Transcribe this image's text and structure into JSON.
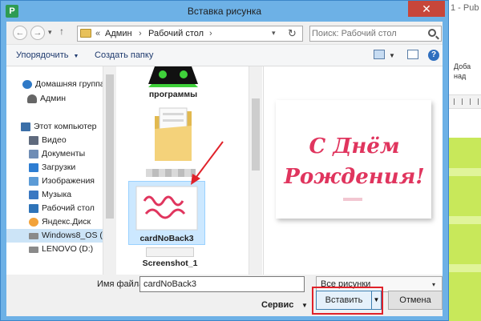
{
  "background_app": {
    "title_fragment": "1 - Pub",
    "ribbon_line1": "Доба",
    "ribbon_line2": "над"
  },
  "dialog": {
    "title": "Вставка рисунка",
    "close_glyph": "✕",
    "app_icon_glyph": "P"
  },
  "nav": {
    "back_glyph": "←",
    "forward_glyph": "→",
    "recent_glyph": "▾",
    "up_glyph": "↑",
    "crumb_prefix": "«",
    "breadcrumb": [
      "Админ",
      "Рабочий стол"
    ],
    "crumb_sep": "›",
    "address_drop_glyph": "▾",
    "refresh_glyph": "↻",
    "search_placeholder": "Поиск: Рабочий стол"
  },
  "toolbar": {
    "organize_label": "Упорядочить",
    "organize_arrow": "▼",
    "new_folder_label": "Создать папку",
    "view_drop_glyph": "▼",
    "help_glyph": "?"
  },
  "sidebar": {
    "items": [
      {
        "label": "Домашняя группа",
        "icon": "homegroup-icon",
        "color": "#2f79c6"
      },
      {
        "label": "Админ",
        "icon": "user-icon",
        "color": "#666666"
      },
      {
        "label": "Этот компьютер",
        "icon": "computer-icon",
        "color": "#3b6fa8"
      },
      {
        "label": "Видео",
        "icon": "video-folder-icon",
        "color": "#5f6a7d"
      },
      {
        "label": "Документы",
        "icon": "documents-folder-icon",
        "color": "#6f8db5"
      },
      {
        "label": "Загрузки",
        "icon": "downloads-folder-icon",
        "color": "#2d7dd2"
      },
      {
        "label": "Изображения",
        "icon": "pictures-folder-icon",
        "color": "#5c9bd6"
      },
      {
        "label": "Музыка",
        "icon": "music-folder-icon",
        "color": "#3a78c2"
      },
      {
        "label": "Рабочий стол",
        "icon": "desktop-folder-icon",
        "color": "#2e73b8"
      },
      {
        "label": "Яндекс.Диск",
        "icon": "yandex-disk-icon",
        "color": "#f2a23a"
      },
      {
        "label": "Windows8_OS (C",
        "icon": "drive-c-icon",
        "color": "#8a8a8a"
      },
      {
        "label": "LENOVO (D:)",
        "icon": "drive-d-icon",
        "color": "#8a8a8a"
      }
    ]
  },
  "files": {
    "items": [
      {
        "label": "программы"
      },
      {
        "label": ""
      },
      {
        "label": "cardNoBack3"
      },
      {
        "label": "Screenshot_1"
      }
    ]
  },
  "preview": {
    "card_line1": "С Днём",
    "card_line2": "Рождения!",
    "accent": "#e0355e"
  },
  "bottom": {
    "filename_label": "Имя файла:",
    "filename_value": "cardNoBack3",
    "filter_value": "Все рисунки",
    "filter_arrow": "▾",
    "service_label": "Сервис",
    "service_arrow": "▼",
    "insert_label": "Вставить",
    "insert_drop_glyph": "▼",
    "cancel_label": "Отмена"
  },
  "colors": {
    "titlebar": "#6db1e6",
    "close": "#c7463a",
    "highlight": "#e0222a",
    "selection": "#cce8ff"
  }
}
